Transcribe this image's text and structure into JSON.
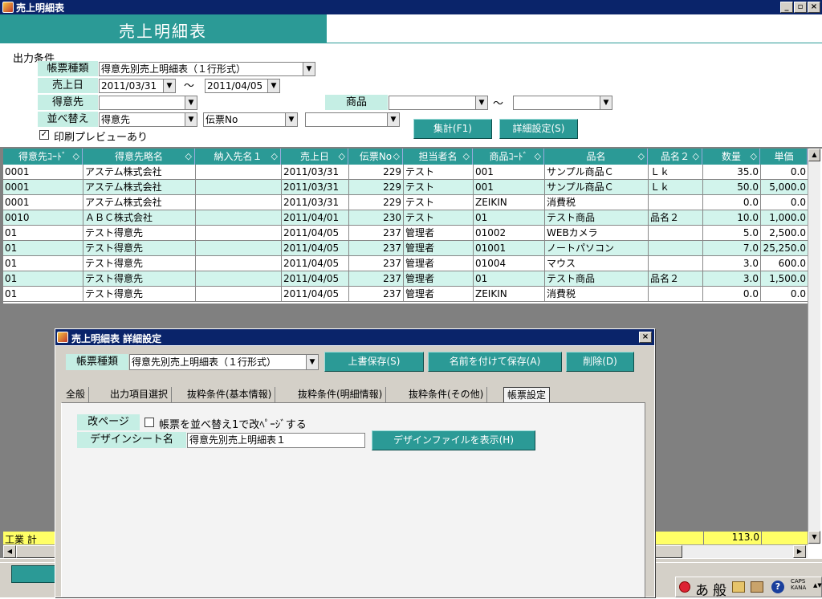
{
  "window": {
    "title": "売上明細表",
    "btn_min": "_",
    "btn_restore": "▫",
    "btn_close": "×"
  },
  "banner": {
    "title": "売上明細表"
  },
  "conditions": {
    "section_label": "出力条件",
    "report_type_label": "帳票種類",
    "report_type_value": "得意先別売上明細表（１行形式）",
    "sales_date_label": "売上日",
    "date_from": "2011/03/31",
    "date_to": "2011/04/05",
    "tilde": "〜",
    "customer_label": "得意先",
    "customer_value": "",
    "product_label": "商品",
    "product_from": "",
    "product_to": "",
    "sort_label": "並べ替え",
    "sort1": "得意先",
    "sort2": "伝票No",
    "sort3": "",
    "preview_checkbox": "印刷プレビューあり",
    "aggregate_button": "集計(F1)",
    "detail_button": "詳細設定(S)"
  },
  "grid": {
    "columns": [
      "得意先ｺｰﾄﾞ",
      "得意先略名",
      "納入先名１",
      "売上日",
      "伝票No",
      "担当者名",
      "商品ｺｰﾄﾞ",
      "品名",
      "品名２",
      "数量",
      "単価"
    ],
    "sort_glyph": "◇",
    "rows": [
      [
        "0001",
        "アステム株式会社",
        "",
        "2011/03/31",
        "229",
        "テスト",
        "001",
        "サンプル商品Ｃ",
        "Ｌｋ",
        "35.0",
        "0.0"
      ],
      [
        "0001",
        "アステム株式会社",
        "",
        "2011/03/31",
        "229",
        "テスト",
        "001",
        "サンプル商品Ｃ",
        "Ｌｋ",
        "50.0",
        "5,000.0"
      ],
      [
        "0001",
        "アステム株式会社",
        "",
        "2011/03/31",
        "229",
        "テスト",
        "ZEIKIN",
        "消費税",
        "",
        "0.0",
        "0.0"
      ],
      [
        "0010",
        "ＡＢＣ株式会社",
        "",
        "2011/04/01",
        "230",
        "テスト",
        "01",
        "テスト商品",
        "品名２",
        "10.0",
        "1,000.0"
      ],
      [
        "01",
        "テスト得意先",
        "",
        "2011/04/05",
        "237",
        "管理者",
        "01002",
        "WEBカメラ",
        "",
        "5.0",
        "2,500.0"
      ],
      [
        "01",
        "テスト得意先",
        "",
        "2011/04/05",
        "237",
        "管理者",
        "01001",
        "ノートパソコン",
        "",
        "7.0",
        "25,250.0"
      ],
      [
        "01",
        "テスト得意先",
        "",
        "2011/04/05",
        "237",
        "管理者",
        "01004",
        "マウス",
        "",
        "3.0",
        "600.0"
      ],
      [
        "01",
        "テスト得意先",
        "",
        "2011/04/05",
        "237",
        "管理者",
        "01",
        "テスト商品",
        "品名２",
        "3.0",
        "1,500.0"
      ],
      [
        "01",
        "テスト得意先",
        "",
        "2011/04/05",
        "237",
        "管理者",
        "ZEIKIN",
        "消費税",
        "",
        "0.0",
        "0.0"
      ]
    ],
    "total_label": "工業 計",
    "total_qty": "113.0"
  },
  "dialog": {
    "title": "売上明細表 詳細設定",
    "close": "×",
    "report_type_label": "帳票種類",
    "report_type_value": "得意先別売上明細表（１行形式）",
    "overwrite_button": "上書保存(S)",
    "saveas_button": "名前を付けて保存(A)",
    "delete_button": "削除(D)",
    "tabs": [
      "全般",
      "出力項目選択",
      "抜粋条件(基本情報)",
      "抜粋条件(明細情報)",
      "抜粋条件(その他)",
      "帳票設定"
    ],
    "active_tab": 5,
    "page_break_label": "改ページ",
    "page_break_checkbox": "帳票を並べ替え1で改ﾍﾟｰｼﾞする",
    "design_sheet_label": "デザインシート名",
    "design_sheet_value": "得意先別売上明細表１",
    "show_design_button": "デザインファイルを表示(H)"
  },
  "taskbar": {
    "ime_a": "あ",
    "ime_mode": "般",
    "help": "?",
    "caps": "CAPS",
    "kana": "KANA"
  },
  "colors": {
    "teal": "#2b9a96",
    "mint": "#c5eee4",
    "row_alt": "#d2f4ec",
    "title_blue": "#0a246a",
    "total_yellow": "#ffff66"
  }
}
